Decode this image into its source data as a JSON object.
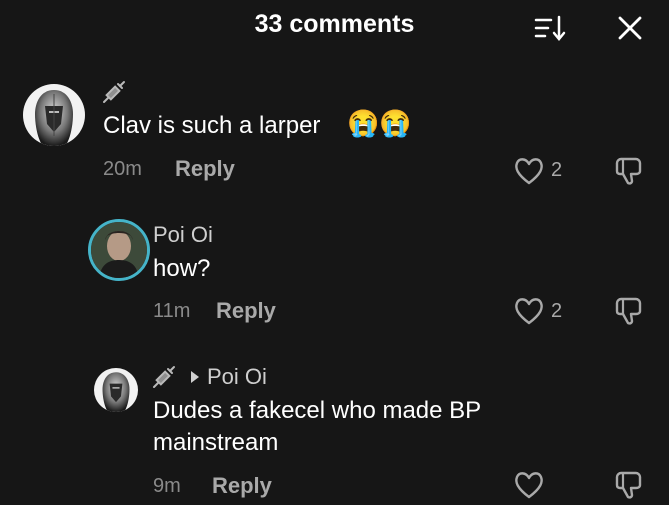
{
  "header": {
    "title": "33 comments",
    "sort_icon": "sort-icon",
    "close_icon": "close-icon"
  },
  "comments": [
    {
      "user": "",
      "text": "Clav is such a larper",
      "emoji": "😭😭",
      "time": "20m",
      "reply": "Reply",
      "likes": "2"
    },
    {
      "user": "Poi Oi",
      "text": "how?",
      "time": "11m",
      "reply": "Reply",
      "likes": "2"
    },
    {
      "user": "Poi Oi",
      "text": "Dudes a fakecel who made BP mainstream",
      "time": "9m",
      "reply": "Reply",
      "likes": ""
    }
  ],
  "colors": {
    "background": "#161616",
    "avatar_ring": "#45b4c9",
    "muted": "#8a8a8a"
  }
}
